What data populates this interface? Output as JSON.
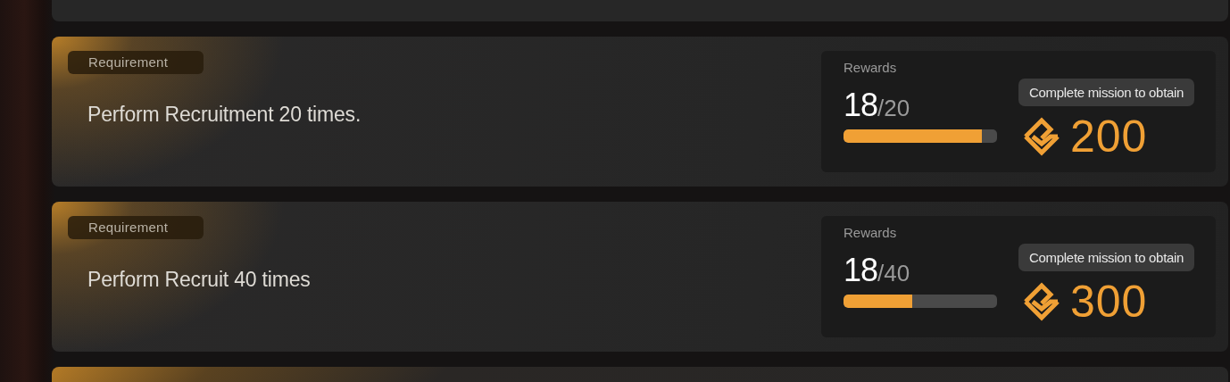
{
  "missions": [
    {
      "tag": "Requirement",
      "description": "Perform Recruitment 20 times.",
      "rewards_label": "Rewards",
      "progress": "18",
      "target": "/20",
      "level": 0.9,
      "reward_status": "Complete mission to obtain",
      "reward_amount": "200"
    },
    {
      "tag": "Requirement",
      "description": "Perform Recruit 40 times",
      "rewards_label": "Rewards",
      "progress": "18",
      "target": "/40",
      "level": 0.45,
      "reward_status": "Complete mission to obtain",
      "reward_amount": "300"
    }
  ]
}
